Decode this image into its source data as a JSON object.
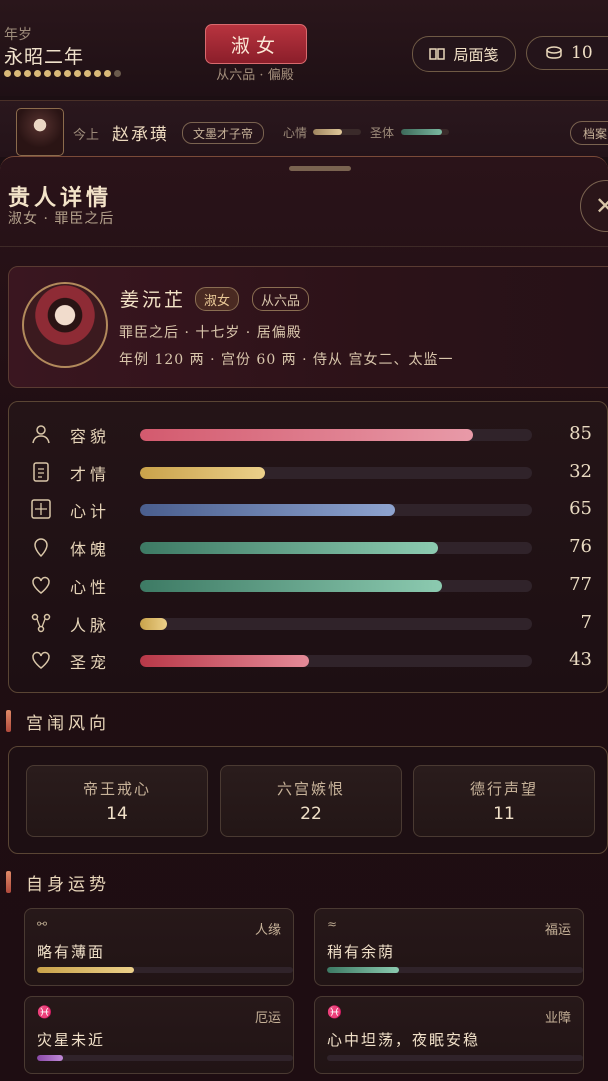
{
  "header": {
    "era_label": "年岁",
    "era_year": "永昭二年",
    "rank": "淑女",
    "rank_sub": "从六品 · 偏殿",
    "book_button": "局面笺",
    "coins": "10"
  },
  "emperor": {
    "label": "今上",
    "name": "赵承璜",
    "tag": "文墨才子帝",
    "mood_label": "心情",
    "mood_level": 0.6,
    "health_label": "圣体",
    "health_level": 0.85,
    "archive_button": "档案"
  },
  "panel": {
    "title": "贵人详情",
    "subtitle": "淑女 · 罪臣之后"
  },
  "profile": {
    "name": "姜沅芷",
    "rank_tag": "淑女",
    "grade_tag": "从六品",
    "line1": "罪臣之后 · 十七岁 · 居偏殿",
    "line2": "年例 120 两 · 宫份 60 两 · 侍从 宫女二、太监一"
  },
  "stats": [
    {
      "label": "容貌",
      "value": 85,
      "icon": "person-icon",
      "color": "#d35a6e",
      "color2": "#e89aa8"
    },
    {
      "label": "才情",
      "value": 32,
      "icon": "scroll-icon",
      "color": "#c9a24a",
      "color2": "#ecd08a"
    },
    {
      "label": "心计",
      "value": 65,
      "icon": "grid-icon",
      "color": "#4a5e8e",
      "color2": "#8ea3cf"
    },
    {
      "label": "体魄",
      "value": 76,
      "icon": "pin-icon",
      "color": "#3d7a64",
      "color2": "#8ccab0"
    },
    {
      "label": "心性",
      "value": 77,
      "icon": "heart-icon",
      "color": "#3d7a64",
      "color2": "#8ccab0"
    },
    {
      "label": "人脉",
      "value": 7,
      "icon": "network-icon",
      "color": "#c9a24a",
      "color2": "#ecd08a"
    },
    {
      "label": "圣宠",
      "value": 43,
      "icon": "heart-icon",
      "color": "#b83848",
      "color2": "#e48a98"
    }
  ],
  "trend": {
    "title": "宫闱风向",
    "cards": [
      {
        "label": "帝王戒心",
        "value": "14"
      },
      {
        "label": "六宫嫉恨",
        "value": "22"
      },
      {
        "label": "德行声望",
        "value": "11"
      }
    ]
  },
  "fortune": {
    "title": "自身运势",
    "cards": [
      {
        "icon": "network-icon",
        "category": "人缘",
        "text": "略有薄面",
        "level": 0.38,
        "color": "#c9a24a",
        "color2": "#ecd08a"
      },
      {
        "icon": "wave-icon",
        "category": "福运",
        "text": "稍有余荫",
        "level": 0.28,
        "color": "#3d7a64",
        "color2": "#8ccab0"
      },
      {
        "icon": "pisces-icon",
        "category": "厄运",
        "text": "灾星未近",
        "level": 0.1,
        "color": "#8a4aa8",
        "color2": "#c08ad8"
      },
      {
        "icon": "pisces-icon",
        "category": "业障",
        "text": "心中坦荡，夜眠安稳",
        "level": 0.0,
        "color": "#8a4aa8",
        "color2": "#c08ad8"
      }
    ]
  }
}
